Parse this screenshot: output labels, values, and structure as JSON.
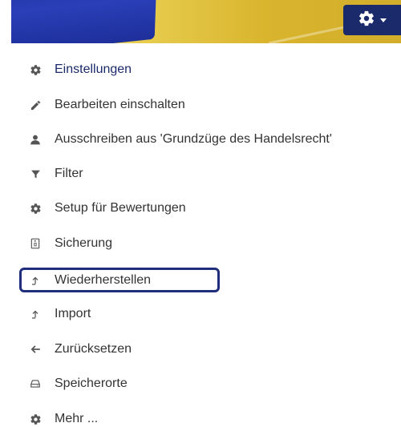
{
  "header": {
    "gear_icon": "gear-icon",
    "caret_icon": "caret-down-icon",
    "colors": {
      "button": "#1b2a6a",
      "accent": "#1b2a6a",
      "highlight": "#1f2d7a"
    }
  },
  "menu": {
    "items": [
      {
        "label": "Einstellungen",
        "icon": "gear-icon"
      },
      {
        "label": "Bearbeiten einschalten",
        "icon": "pencil-icon"
      },
      {
        "label": "Ausschreiben aus 'Grundzüge des Handelsrecht'",
        "icon": "user-icon"
      },
      {
        "label": "Filter",
        "icon": "filter-icon"
      },
      {
        "label": "Setup für Bewertungen",
        "icon": "gear-icon"
      },
      {
        "label": "Sicherung",
        "icon": "backup-file-icon"
      },
      {
        "label": "Wiederherstellen",
        "icon": "restore-upload-icon"
      },
      {
        "label": "Import",
        "icon": "upload-icon"
      },
      {
        "label": "Zurücksetzen",
        "icon": "arrow-left-icon"
      },
      {
        "label": "Speicherorte",
        "icon": "hard-drive-icon"
      },
      {
        "label": "Mehr ...",
        "icon": "gear-icon"
      }
    ]
  }
}
